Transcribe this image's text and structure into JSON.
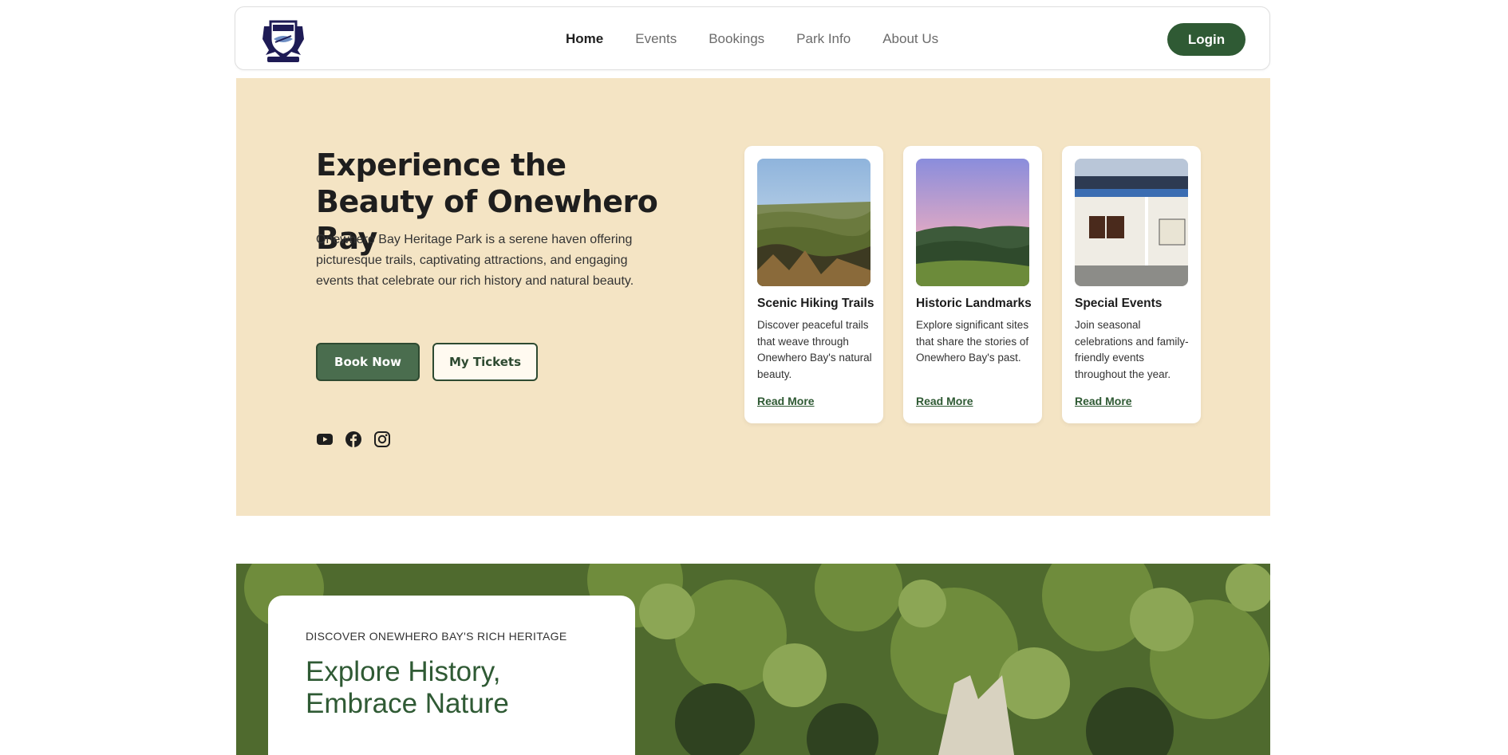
{
  "nav": {
    "logo_alt": "Onewhero crest",
    "links": [
      {
        "label": "Home",
        "active": true
      },
      {
        "label": "Events"
      },
      {
        "label": "Bookings"
      },
      {
        "label": "Park Info"
      },
      {
        "label": "About Us"
      }
    ],
    "login_label": "Login"
  },
  "hero": {
    "title": "Experience the Beauty of Onewhero Bay",
    "description": "Onewhero Bay Heritage Park is a serene haven offering picturesque trails, captivating attractions, and engaging events that celebrate our rich history and natural beauty.",
    "primary_button": "Book Now",
    "secondary_button": "My Tickets",
    "socials": [
      "youtube-icon",
      "facebook-icon",
      "instagram-icon"
    ],
    "cards": [
      {
        "title": "Scenic Hiking Trails",
        "text": "Discover peaceful trails that weave through Onewhero Bay's natural beauty.",
        "link": "Read More"
      },
      {
        "title": "Historic Landmarks",
        "text": "Explore significant sites that share the stories of Onewhero Bay's past.",
        "link": "Read More"
      },
      {
        "title": "Special Events",
        "text": "Join seasonal celebrations and family-friendly events throughout the year.",
        "link": "Read More"
      }
    ]
  },
  "heritage": {
    "eyebrow": "DISCOVER ONEWHERO BAY'S RICH HERITAGE",
    "title": "Explore History, Embrace Nature"
  },
  "colors": {
    "brand_green": "#2f5a34",
    "hero_bg": "#f4e4c4"
  }
}
